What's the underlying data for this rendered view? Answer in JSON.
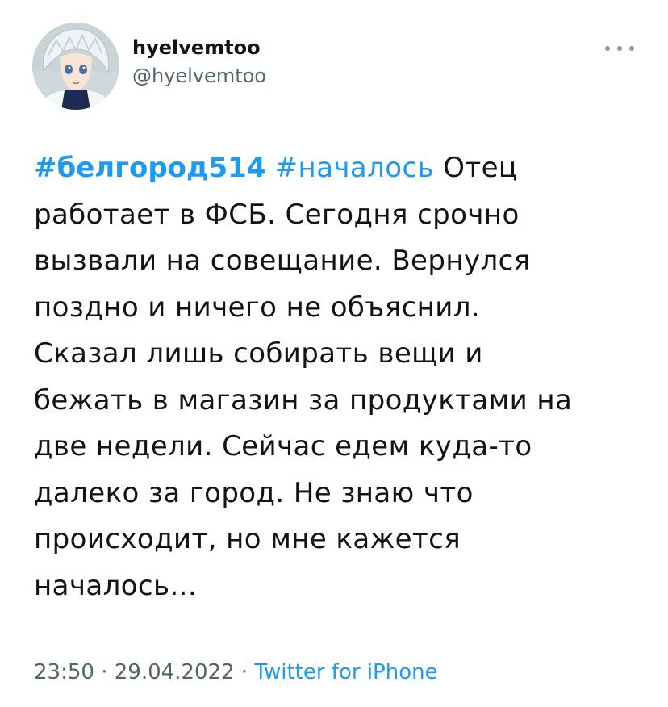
{
  "author": {
    "display_name": "hyelvemtoo",
    "handle": "@hyelvemtoo"
  },
  "more_icon": "more-horizontal-icon",
  "tweet": {
    "hashtag_1": "#белгород514",
    "hashtag_2": "#началось",
    "line1_rest": " Отец",
    "lines": [
      "работает в ФСБ. Сегодня срочно",
      "вызвали на совещание. Вернулся",
      "поздно и ничего не объяснил.",
      "Сказал лишь собирать вещи и",
      "бежать в магазин за продуктами на",
      "две недели. Сейчас едем куда-то",
      "далеко за город. Не знаю что",
      "происходит, но мне кажется",
      "началось..."
    ]
  },
  "meta": {
    "time": "23:50",
    "separator": " · ",
    "date": "29.04.2022",
    "source": "Twitter for iPhone"
  },
  "colors": {
    "accent": "#1d9bf0",
    "secondary_text": "#536471",
    "primary_text": "#0f1419"
  }
}
